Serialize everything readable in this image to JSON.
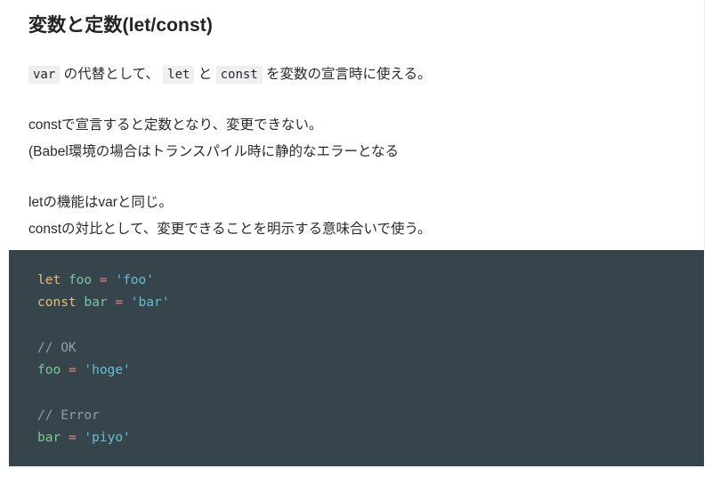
{
  "document": {
    "title": "変数と定数(let/const)",
    "paragraphs": [
      {
        "id": "lead",
        "segments": [
          {
            "type": "code",
            "text": "var"
          },
          {
            "type": "text",
            "text": " の代替として、 "
          },
          {
            "type": "code",
            "text": "let"
          },
          {
            "type": "text",
            "text": " と "
          },
          {
            "type": "code",
            "text": "const"
          },
          {
            "type": "text",
            "text": " を変数の宣言時に使える。"
          }
        ]
      },
      {
        "id": "const-desc",
        "lines": [
          "constで宣言すると定数となり、変更できない。",
          "(Babel環境の場合はトランスパイル時に静的なエラーとなる"
        ]
      },
      {
        "id": "let-desc",
        "lines": [
          "letの機能はvarと同じ。",
          "constの対比として、変更できることを明示する意味合いで使う。"
        ]
      }
    ],
    "code_block": {
      "language": "javascript",
      "background": "#36454c",
      "lines": [
        [
          {
            "cls": "tok-kw",
            "t": "let"
          },
          {
            "cls": "tok-plain",
            "t": " "
          },
          {
            "cls": "tok-var",
            "t": "foo"
          },
          {
            "cls": "tok-plain",
            "t": " "
          },
          {
            "cls": "tok-op",
            "t": "="
          },
          {
            "cls": "tok-plain",
            "t": " "
          },
          {
            "cls": "tok-str",
            "t": "'foo'"
          }
        ],
        [
          {
            "cls": "tok-kw",
            "t": "const"
          },
          {
            "cls": "tok-plain",
            "t": " "
          },
          {
            "cls": "tok-var",
            "t": "bar"
          },
          {
            "cls": "tok-plain",
            "t": " "
          },
          {
            "cls": "tok-op",
            "t": "="
          },
          {
            "cls": "tok-plain",
            "t": " "
          },
          {
            "cls": "tok-str",
            "t": "'bar'"
          }
        ],
        [],
        [
          {
            "cls": "tok-com",
            "t": "// OK"
          }
        ],
        [
          {
            "cls": "tok-var",
            "t": "foo"
          },
          {
            "cls": "tok-plain",
            "t": " "
          },
          {
            "cls": "tok-op",
            "t": "="
          },
          {
            "cls": "tok-plain",
            "t": " "
          },
          {
            "cls": "tok-str",
            "t": "'hoge'"
          }
        ],
        [],
        [
          {
            "cls": "tok-com",
            "t": "// Error"
          }
        ],
        [
          {
            "cls": "tok-var",
            "t": "bar"
          },
          {
            "cls": "tok-plain",
            "t": " "
          },
          {
            "cls": "tok-op",
            "t": "="
          },
          {
            "cls": "tok-plain",
            "t": " "
          },
          {
            "cls": "tok-str",
            "t": "'piyo'"
          }
        ]
      ]
    }
  },
  "theme": {
    "page_background": "#ffffff",
    "text_color": "#2b2b2b",
    "title_color": "#222426",
    "inline_code_background": "#efeff0",
    "code_background": "#36454c",
    "keyword_color": "#e5c07b",
    "identifier_color": "#7ec699",
    "operator_color": "#e87e8a",
    "string_color": "#63c0d4",
    "comment_color": "#8f9fa4"
  }
}
